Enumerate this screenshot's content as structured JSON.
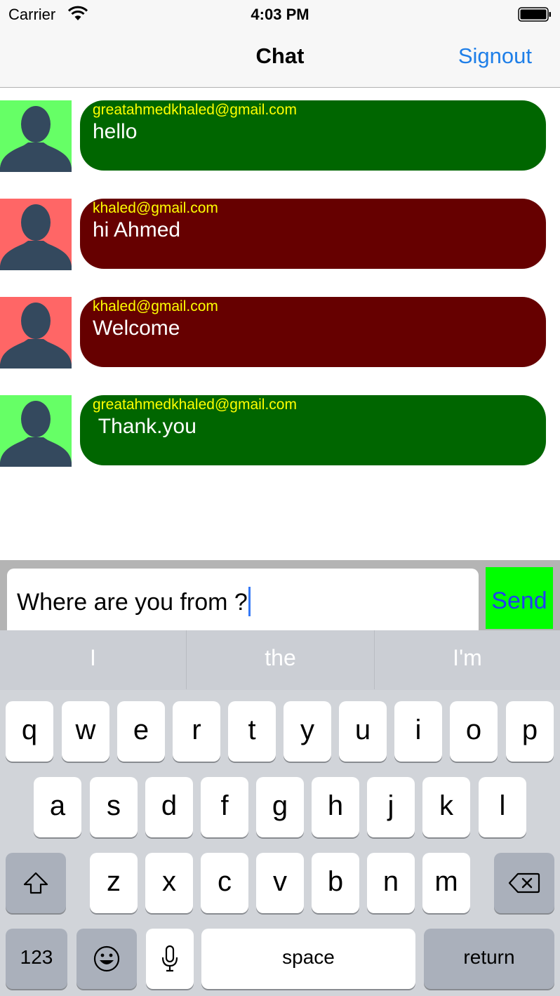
{
  "status": {
    "carrier": "Carrier",
    "time": "4:03 PM"
  },
  "nav": {
    "title": "Chat",
    "signout": "Signout"
  },
  "messages": [
    {
      "sender": "greatahmedkhaled@gmail.com",
      "text": "hello",
      "bubble_color": "#006600",
      "avatar_color": "#66ff66"
    },
    {
      "sender": "khaled@gmail.com",
      "text": "hi Ahmed",
      "bubble_color": "#660000",
      "avatar_color": "#ff6666"
    },
    {
      "sender": "khaled@gmail.com",
      "text": "Welcome",
      "bubble_color": "#660000",
      "avatar_color": "#ff6666"
    },
    {
      "sender": "greatahmedkhaled@gmail.com",
      "text": " Thank.you",
      "bubble_color": "#006600",
      "avatar_color": "#66ff66"
    }
  ],
  "input": {
    "value": "Where are you from ?",
    "send_label": "Send"
  },
  "suggestions": [
    "I",
    "the",
    "I'm"
  ],
  "keyboard": {
    "row1": [
      "q",
      "w",
      "e",
      "r",
      "t",
      "y",
      "u",
      "i",
      "o",
      "p"
    ],
    "row2": [
      "a",
      "s",
      "d",
      "f",
      "g",
      "h",
      "j",
      "k",
      "l"
    ],
    "row3": [
      "z",
      "x",
      "c",
      "v",
      "b",
      "n",
      "m"
    ],
    "numbers_label": "123",
    "space_label": "space",
    "return_label": "return"
  },
  "colors": {
    "accent": "#1f7fe8",
    "send_bg": "#00ff00",
    "sender_text": "#ffff00"
  }
}
